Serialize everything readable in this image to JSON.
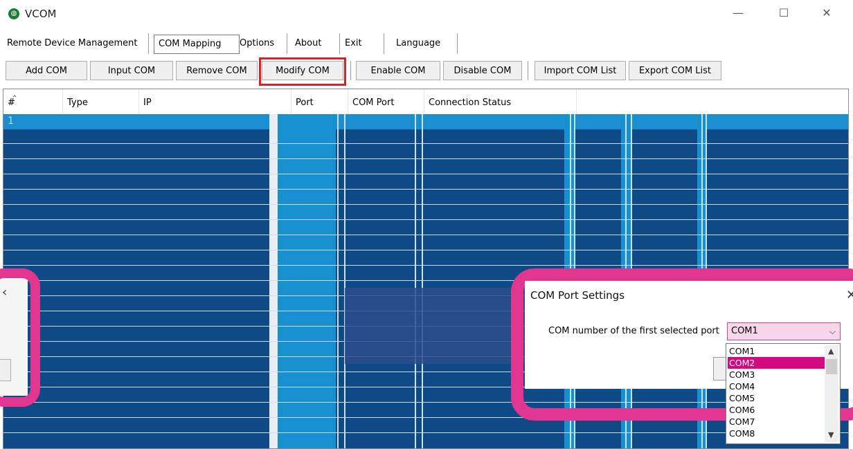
{
  "window": {
    "title": "VCOM",
    "controls": {
      "minimize": "—",
      "maximize": "☐",
      "close": "✕"
    }
  },
  "menu": {
    "items": [
      {
        "label": "Remote Device Management"
      },
      {
        "label": "COM Mapping",
        "active": true
      },
      {
        "label": "Options"
      },
      {
        "label": "About"
      },
      {
        "label": "Exit"
      },
      {
        "label": "Language"
      }
    ]
  },
  "toolbar": {
    "add_com": "Add COM",
    "input_com": "Input COM",
    "remove_com": "Remove COM",
    "modify_com": "Modify COM",
    "enable_com": "Enable COM",
    "disable_com": "Disable COM",
    "import_com_list": "Import COM List",
    "export_com_list": "Export COM List"
  },
  "table": {
    "columns": [
      "#",
      "Type",
      "IP",
      "Port",
      "COM Port",
      "Connection Status"
    ],
    "first_row_index": "1"
  },
  "dialog": {
    "title": "COM Port Settings",
    "close": "✕",
    "label": "COM number of the first selected port",
    "selected": "COM1",
    "options": [
      "COM1",
      "COM2",
      "COM3",
      "COM4",
      "COM5",
      "COM6",
      "COM7",
      "COM8"
    ],
    "highlighted": "COM2"
  },
  "colors": {
    "highlight_red": "#e02020",
    "frame_pink": "#e0368f",
    "selection": "#d6087f",
    "table_bg": "#0f4a86"
  }
}
